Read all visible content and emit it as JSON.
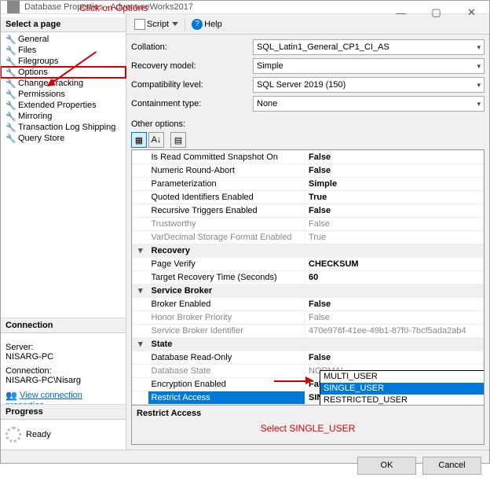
{
  "window": {
    "title": "Database Properties - AdventureWorks2017"
  },
  "annotations": {
    "options": "Click on Options",
    "single": "Select SINGLE_USER"
  },
  "sidebar": {
    "header": "Select a page",
    "items": [
      {
        "label": "General"
      },
      {
        "label": "Files"
      },
      {
        "label": "Filegroups"
      },
      {
        "label": "Options"
      },
      {
        "label": "Change Tracking"
      },
      {
        "label": "Permissions"
      },
      {
        "label": "Extended Properties"
      },
      {
        "label": "Mirroring"
      },
      {
        "label": "Transaction Log Shipping"
      },
      {
        "label": "Query Store"
      }
    ],
    "connection": {
      "header": "Connection",
      "server_label": "Server:",
      "server": "NISARG-PC",
      "conn_label": "Connection:",
      "conn": "NISARG-PC\\Nisarg",
      "viewprops": "View connection properties"
    },
    "progress": {
      "header": "Progress",
      "status": "Ready"
    }
  },
  "toolbar": {
    "script": "Script",
    "help": "Help"
  },
  "form": {
    "collation": {
      "label": "Collation:",
      "value": "SQL_Latin1_General_CP1_CI_AS"
    },
    "recovery": {
      "label": "Recovery model:",
      "value": "Simple"
    },
    "compat": {
      "label": "Compatibility level:",
      "value": "SQL Server 2019 (150)"
    },
    "contain": {
      "label": "Containment type:",
      "value": "None"
    },
    "other": "Other options:"
  },
  "grid": {
    "rows": [
      {
        "k": "Is Read Committed Snapshot On",
        "v": "False"
      },
      {
        "k": "Numeric Round-Abort",
        "v": "False"
      },
      {
        "k": "Parameterization",
        "v": "Simple"
      },
      {
        "k": "Quoted Identifiers Enabled",
        "v": "True"
      },
      {
        "k": "Recursive Triggers Enabled",
        "v": "False"
      },
      {
        "k": "Trustworthy",
        "v": "False",
        "dim": true
      },
      {
        "k": "VarDecimal Storage Format Enabled",
        "v": "True",
        "dim": true
      }
    ],
    "recovery": {
      "cat": "Recovery",
      "page_verify_k": "Page Verify",
      "page_verify_v": "CHECKSUM",
      "target_k": "Target Recovery Time (Seconds)",
      "target_v": "60"
    },
    "sb": {
      "cat": "Service Broker",
      "en_k": "Broker Enabled",
      "en_v": "False",
      "hp_k": "Honor Broker Priority",
      "hp_v": "False",
      "id_k": "Service Broker Identifier",
      "id_v": "470e976f-41ee-49b1-87f0-7bcf5ada2ab4"
    },
    "state": {
      "cat": "State",
      "ro_k": "Database Read-Only",
      "ro_v": "False",
      "st_k": "Database State",
      "st_v": "NORMAL",
      "ee_k": "Encryption Enabled",
      "ee_v": "False",
      "ra_k": "Restrict Access",
      "ra_v": "SINGLE_USER"
    },
    "dropdown": {
      "opt1": "MULTI_USER",
      "opt2": "SINGLE_USER",
      "opt3": "RESTRICTED_USER"
    },
    "desc_title": "Restrict Access"
  },
  "buttons": {
    "ok": "OK",
    "cancel": "Cancel"
  }
}
